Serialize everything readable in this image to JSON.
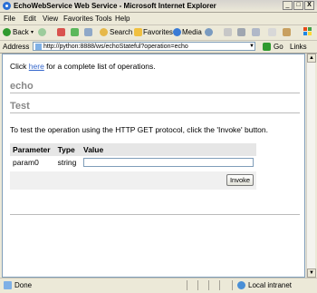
{
  "window": {
    "title": "EchoWebService Web Service - Microsoft Internet Explorer",
    "min_label": "_",
    "max_label": "□",
    "close_label": "X"
  },
  "menu": [
    "File",
    "Edit",
    "View",
    "Favorites",
    "Tools",
    "Help"
  ],
  "toolbar": {
    "back_label": "Back",
    "search_label": "Search",
    "favorites_label": "Favorites",
    "media_label": "Media"
  },
  "address": {
    "label": "Address",
    "url": "http://python:8888/ws/echoStateful?operation=echo",
    "go_label": "Go",
    "links_label": "Links"
  },
  "page": {
    "intro_prefix": "Click ",
    "intro_link": "here",
    "intro_suffix": " for a complete list of operations.",
    "operation_heading": "echo",
    "test_heading": "Test",
    "test_instructions": "To test the operation using the HTTP GET protocol, click the 'Invoke' button.",
    "table": {
      "headers": [
        "Parameter",
        "Type",
        "Value"
      ],
      "rows": [
        {
          "parameter": "param0",
          "type": "string",
          "value": ""
        }
      ]
    },
    "invoke_label": "Invoke"
  },
  "status": {
    "text": "Done",
    "zone": "Local intranet"
  },
  "icons": [
    "ie-icon",
    "windows-logo-icon",
    "back-icon",
    "forward-icon",
    "stop-icon",
    "refresh-icon",
    "home-icon",
    "search-icon",
    "favorites-icon",
    "media-icon",
    "history-icon",
    "mail-icon",
    "print-icon",
    "edit-icon",
    "page-icon",
    "go-icon",
    "intranet-icon"
  ]
}
